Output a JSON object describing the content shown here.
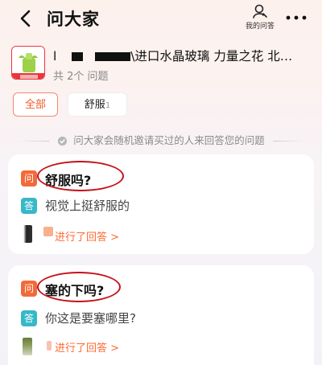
{
  "header": {
    "title": "问大家",
    "my_questions_label": "我的问答"
  },
  "product": {
    "title_prefix": "l",
    "title_suffix": "\\进口水晶玻璃 力量之花 北…",
    "question_count": "共 2个 问题"
  },
  "filters": [
    {
      "label": "全部",
      "count": "",
      "selected": true
    },
    {
      "label": "舒服",
      "count": "1",
      "selected": false
    }
  ],
  "notice": "问大家会随机邀请买过的人来回答您的问题",
  "questions": [
    {
      "q_badge": "问",
      "question": "舒服吗?",
      "a_badge": "答",
      "answer": "视觉上挺舒服的",
      "answered_label": "进行了回答 >"
    },
    {
      "q_badge": "问",
      "question": "塞的下吗?",
      "a_badge": "答",
      "answer": "你这是要塞哪里?",
      "answered_label": "进行了回答 >"
    }
  ],
  "colors": {
    "accent": "#ff6a33",
    "question_badge": "#f26a3a",
    "answer_badge": "#37b8c8",
    "annotation": "#c6111a"
  }
}
